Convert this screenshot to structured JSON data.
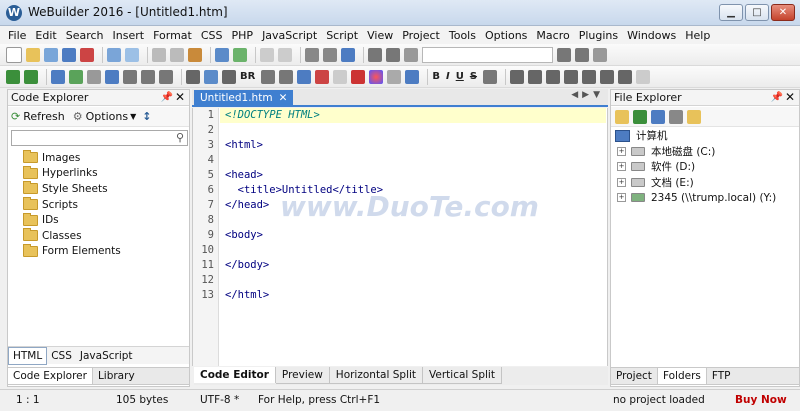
{
  "window": {
    "title": "WeBuilder 2016 - [Untitled1.htm]",
    "logo_letter": "W"
  },
  "menu": [
    "File",
    "Edit",
    "Search",
    "Insert",
    "Format",
    "CSS",
    "PHP",
    "JavaScript",
    "Script",
    "View",
    "Project",
    "Tools",
    "Options",
    "Macro",
    "Plugins",
    "Windows",
    "Help"
  ],
  "toolbar2_text": {
    "br": "BR"
  },
  "code_explorer": {
    "header": "Code Explorer",
    "refresh": "Refresh",
    "options": "Options",
    "items": [
      "Images",
      "Hyperlinks",
      "Style Sheets",
      "Scripts",
      "IDs",
      "Classes",
      "Form Elements"
    ],
    "lang_tabs": [
      "HTML",
      "CSS",
      "JavaScript"
    ],
    "bottom_tabs": [
      "Code Explorer",
      "Library"
    ]
  },
  "editor": {
    "tab": "Untitled1.htm",
    "line_numbers": [
      "1",
      "2",
      "3",
      "4",
      "5",
      "6",
      "7",
      "8",
      "9",
      "10",
      "11",
      "12",
      "13"
    ],
    "lines": [
      "<!DOCTYPE HTML>",
      "",
      "<html>",
      "",
      "<head>",
      "  <title>Untitled</title>",
      "</head>",
      "",
      "<body>",
      "",
      "</body>",
      "",
      "</html>"
    ],
    "bottom_tabs": [
      "Code Editor",
      "Preview",
      "Horizontal Split",
      "Vertical Split"
    ]
  },
  "file_explorer": {
    "header": "File Explorer",
    "root": "计算机",
    "drives": [
      "本地磁盘 (C:)",
      "软件 (D:)",
      "文档 (E:)",
      "2345 (\\\\trump.local) (Y:)"
    ],
    "bottom_tabs": [
      "Project",
      "Folders",
      "FTP"
    ]
  },
  "status": {
    "position": "1 : 1",
    "size": "105 bytes",
    "encoding": "UTF-8 *",
    "help": "For Help, press Ctrl+F1",
    "project": "no project loaded",
    "buy": "Buy Now"
  },
  "watermark": "www.DuoTe.com",
  "colors": {
    "accent": "#3f7fd0",
    "highlight_line": "#ffffcc",
    "buy_now": "#c00000"
  }
}
